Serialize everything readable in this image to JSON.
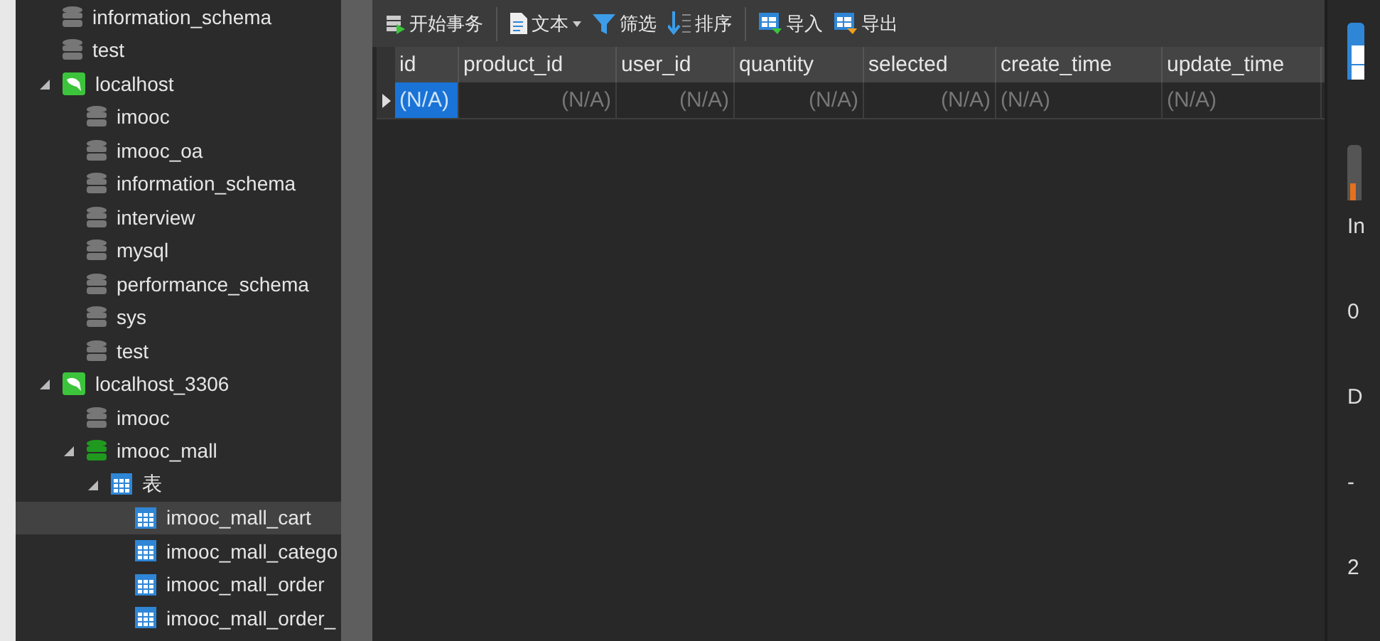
{
  "tree": [
    {
      "label": "information_schema",
      "kind": "database",
      "open": false,
      "selected": false
    },
    {
      "label": "test",
      "kind": "database",
      "open": false,
      "selected": false
    },
    {
      "label": "localhost",
      "kind": "connection",
      "expanded": true,
      "selected": false,
      "children": [
        {
          "label": "imooc",
          "kind": "database",
          "open": false,
          "selected": false
        },
        {
          "label": "imooc_oa",
          "kind": "database",
          "open": false,
          "selected": false
        },
        {
          "label": "information_schema",
          "kind": "database",
          "open": false,
          "selected": false
        },
        {
          "label": "interview",
          "kind": "database",
          "open": false,
          "selected": false
        },
        {
          "label": "mysql",
          "kind": "database",
          "open": false,
          "selected": false
        },
        {
          "label": "performance_schema",
          "kind": "database",
          "open": false,
          "selected": false
        },
        {
          "label": "sys",
          "kind": "database",
          "open": false,
          "selected": false
        },
        {
          "label": "test",
          "kind": "database",
          "open": false,
          "selected": false
        }
      ]
    },
    {
      "label": "localhost_3306",
      "kind": "connection",
      "expanded": true,
      "selected": false,
      "children": [
        {
          "label": "imooc",
          "kind": "database",
          "open": false,
          "selected": false
        },
        {
          "label": "imooc_mall",
          "kind": "database",
          "open": true,
          "expanded": true,
          "selected": false,
          "children": [
            {
              "label": "表",
              "kind": "group",
              "expanded": true,
              "selected": false,
              "children": [
                {
                  "label": "imooc_mall_cart",
                  "kind": "table",
                  "selected": true
                },
                {
                  "label": "imooc_mall_catego",
                  "kind": "table",
                  "selected": false
                },
                {
                  "label": "imooc_mall_order",
                  "kind": "table",
                  "selected": false
                },
                {
                  "label": "imooc_mall_order_",
                  "kind": "table",
                  "selected": false
                }
              ]
            }
          ]
        }
      ]
    }
  ],
  "toolbar": [
    {
      "buttons": [
        {
          "label": "开始事务",
          "kind": "transaction"
        }
      ]
    },
    {
      "buttons": [
        {
          "label": "文本",
          "kind": "text",
          "dropdown": true
        },
        {
          "label": "筛选",
          "kind": "filter",
          "dropdown": false
        },
        {
          "label": "排序",
          "kind": "sort",
          "dropdown": false
        }
      ]
    },
    {
      "buttons": [
        {
          "label": "导入",
          "kind": "import"
        },
        {
          "label": "导出",
          "kind": "export"
        }
      ]
    }
  ],
  "table": {
    "columns": [
      {
        "label": "id",
        "right_aligned": false
      },
      {
        "label": "product_id",
        "right_aligned": true
      },
      {
        "label": "user_id",
        "right_aligned": true
      },
      {
        "label": "quantity",
        "right_aligned": true
      },
      {
        "label": "selected",
        "right_aligned": true
      },
      {
        "label": "create_time",
        "right_aligned": false
      },
      {
        "label": "update_time",
        "right_aligned": false
      }
    ],
    "rows": [
      {
        "current": true,
        "cells": [
          {
            "text": "(N/A)",
            "selected": true
          },
          {
            "text": "(N/A)",
            "selected": false
          },
          {
            "text": "(N/A)",
            "selected": false
          },
          {
            "text": "(N/A)",
            "selected": false
          },
          {
            "text": "(N/A)",
            "selected": false
          },
          {
            "text": "(N/A)",
            "selected": false
          },
          {
            "text": "(N/A)",
            "selected": false
          }
        ]
      }
    ]
  },
  "info_panel": {
    "values": [
      "In",
      "0",
      "D",
      "-",
      "2"
    ]
  }
}
